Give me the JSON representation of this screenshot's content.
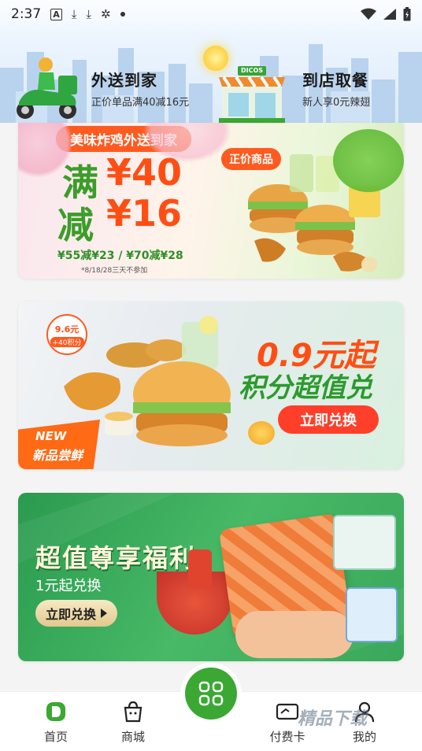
{
  "status_bar": {
    "time": "2:37",
    "icons": [
      "a-icon",
      "download-icon",
      "download-icon",
      "bug-icon",
      "dot-icon"
    ],
    "right_icons": [
      "wifi-icon",
      "signal-icon",
      "battery-icon"
    ]
  },
  "header": {
    "delivery": {
      "title": "外送到家",
      "subtitle": "正价单品满40减16元"
    },
    "pickup": {
      "title": "到店取餐",
      "subtitle": "新人享0元辣翅"
    },
    "store_sign": "DICOS"
  },
  "banner1": {
    "headline": "美味炸鸡外送到家",
    "big1": "满",
    "big2": "减",
    "amount1": "¥40",
    "amount2": "¥16",
    "tiers": "¥55减¥23 / ¥70减¥28",
    "note": "*8/18/28三天不参加",
    "tag": "正价商品"
  },
  "banner2": {
    "price_badge": "9.6元",
    "points_badge": "+40积分",
    "price_title": "0.9元起",
    "subtitle": "积分超值兑",
    "cta": "立即兑换",
    "new_en": "NEW",
    "new_cn": "新品尝鲜"
  },
  "banner3": {
    "title": "超值尊享福利",
    "subtitle": "1元起兑换",
    "cta": "立即兑换"
  },
  "nav": {
    "items": [
      {
        "label": "首页",
        "icon": "home-icon"
      },
      {
        "label": "商城",
        "icon": "shopping-bag-icon"
      },
      {
        "label": "付费卡",
        "icon": "card-icon"
      },
      {
        "label": "我的",
        "icon": "profile-icon"
      }
    ],
    "center_icon": "qr-grid-icon"
  },
  "watermark": "精品下载",
  "colors": {
    "brand_green": "#3aa833",
    "promo_orange": "#ff5a1f"
  }
}
